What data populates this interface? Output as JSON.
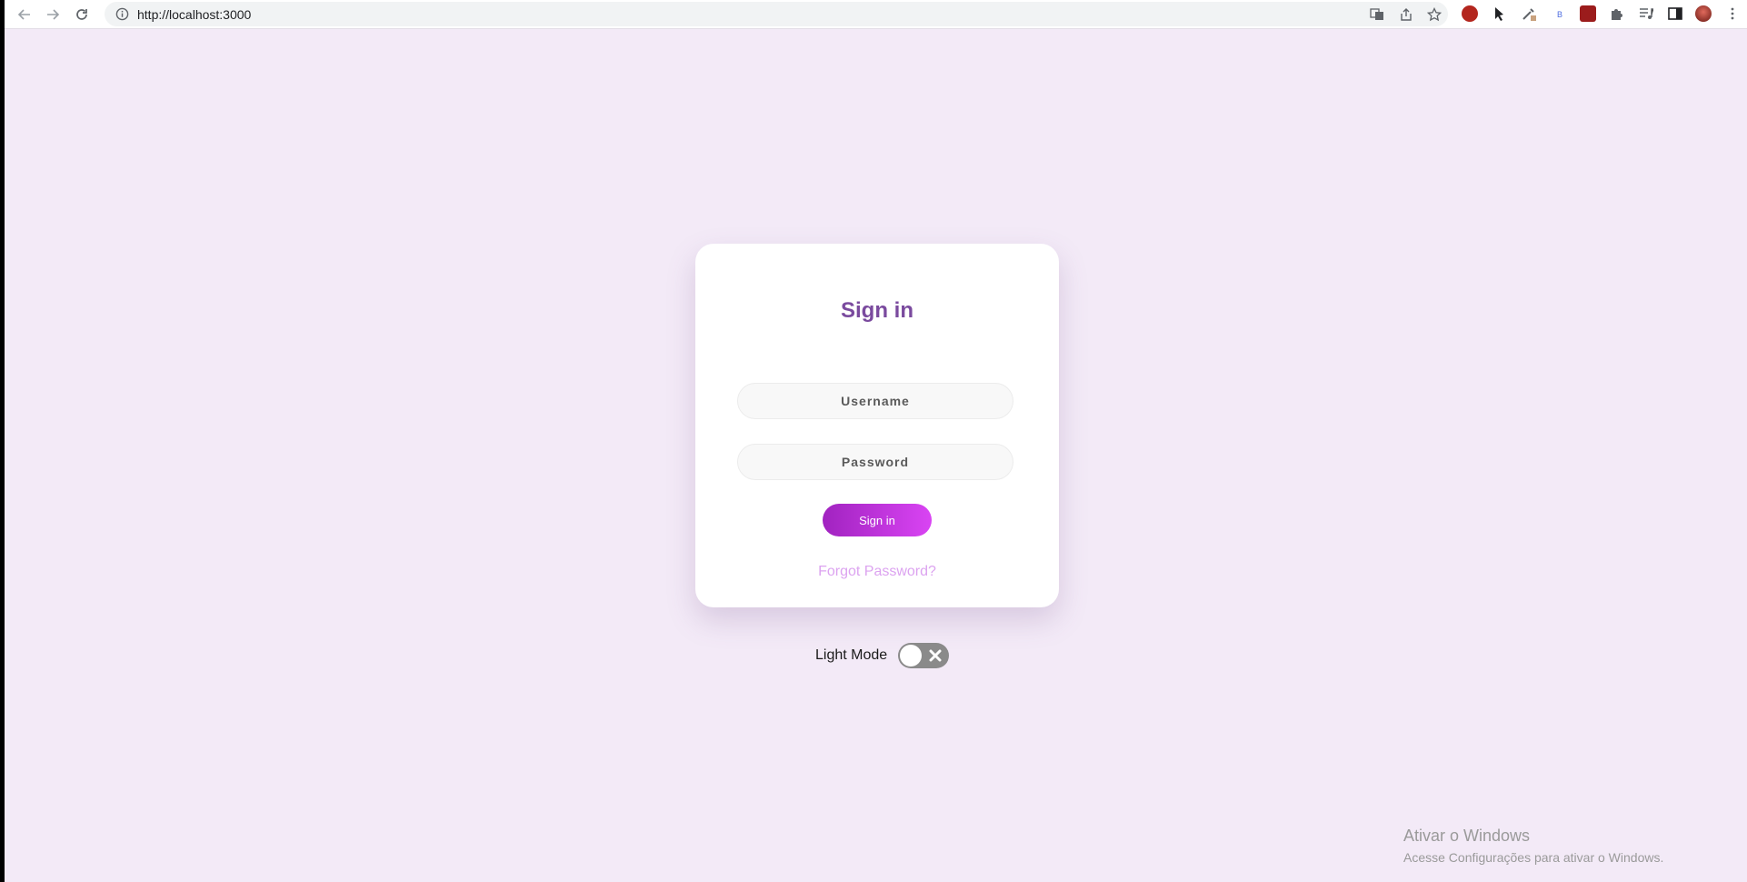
{
  "browser": {
    "url": "http://localhost:3000",
    "toolbar_icons": [
      "translate-icon",
      "share-icon",
      "star-icon"
    ],
    "extensions": [
      "ublock-icon",
      "cursor-icon",
      "eyedropper-icon",
      "b-icon",
      "extension-red-icon",
      "puzzle-icon",
      "media-icon",
      "sidebar-icon",
      "avatar",
      "menu-icon"
    ]
  },
  "login": {
    "title": "Sign in",
    "username_placeholder": "Username",
    "password_placeholder": "Password",
    "submit_label": "Sign in",
    "forgot_label": "Forgot Password?"
  },
  "theme": {
    "label": "Light Mode",
    "dark_enabled": false
  },
  "watermark": {
    "title": "Ativar o Windows",
    "subtitle": "Acesse Configurações para ativar o Windows."
  },
  "colors": {
    "background": "#f3eaf7",
    "title": "#7a4a9e",
    "button_gradient_start": "#a123c0",
    "button_gradient_end": "#d944f3",
    "link": "#dca3f0",
    "toggle_off": "#8a8a8a"
  }
}
